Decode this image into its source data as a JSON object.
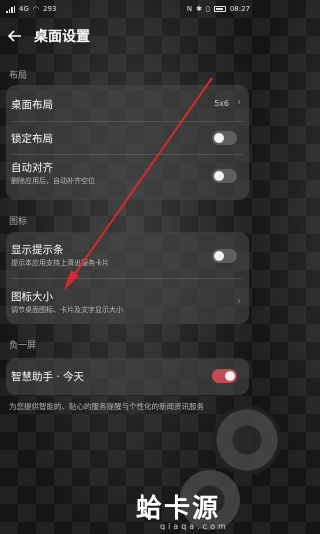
{
  "status_bar": {
    "left_text": "4G",
    "speed": "293",
    "right_icons": [
      "nfc-icon",
      "bluetooth-icon",
      "vibrate-icon",
      "battery-icon"
    ],
    "time": "08:27"
  },
  "header": {
    "back_icon": "back-arrow-icon",
    "title": "桌面设置"
  },
  "sections": {
    "layout": "布局",
    "icons": "图标",
    "minus_one": "负一屏"
  },
  "layout": {
    "desktop_layout": {
      "title": "桌面布局",
      "value": "5x6"
    },
    "lock_layout": {
      "title": "锁定布局",
      "toggle_on": false
    },
    "auto_align": {
      "title": "自动对齐",
      "subtitle": "删除应用后，自动补齐空位",
      "toggle_on": false
    }
  },
  "icons": {
    "show_badge": {
      "title": "显示提示条",
      "subtitle": "提示本应用支持上滑出服务卡片",
      "toggle_on": false
    },
    "icon_size": {
      "title": "图标大小",
      "subtitle": "调节桌面图标、卡片及文字显示大小"
    }
  },
  "minus_one": {
    "smart_assistant": {
      "title": "智慧助手 · 今天",
      "toggle_on": true
    },
    "footnote": "为您提供智能的、贴心的服务提醒与个性化的新闻资讯服务"
  },
  "watermark": {
    "logo": "蛤卡源",
    "url": "qiaqa.com"
  },
  "colors": {
    "toggle_on": "#c34a52",
    "toggle_off": "#5e5e5e",
    "annotation_arrow": "#d8282a"
  }
}
